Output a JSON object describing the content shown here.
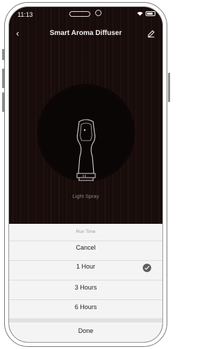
{
  "status": {
    "time": "11:13"
  },
  "nav": {
    "title": "Smart Aroma Diffuser",
    "back_glyph": "‹"
  },
  "device": {
    "mode_label": "Light Spray"
  },
  "sheet": {
    "header": "Run Time",
    "cancel": "Cancel",
    "options": [
      {
        "label": "1 Hour",
        "selected": true
      },
      {
        "label": "3 Hours",
        "selected": false
      },
      {
        "label": "6 Hours",
        "selected": false
      }
    ],
    "done": "Done"
  }
}
